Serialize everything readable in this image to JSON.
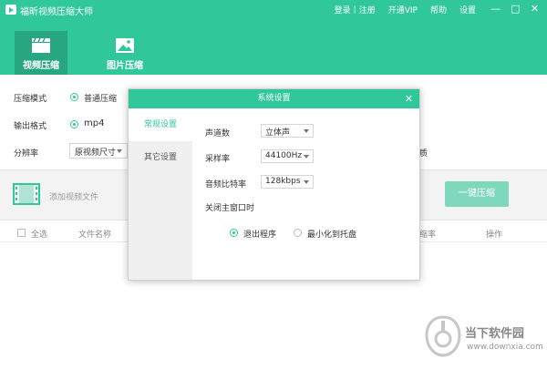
{
  "app": {
    "title": "福昕视频压缩大师"
  },
  "top_menu": {
    "login": "登录",
    "separator": "|",
    "register": "注册",
    "vip": "开通VIP",
    "help": "帮助",
    "settings": "设置"
  },
  "window_controls": {
    "minimize": "—",
    "maximize": "□",
    "close": "✕"
  },
  "main_tabs": [
    {
      "label": "视频压缩",
      "icon": "clapperboard-icon",
      "active": true
    },
    {
      "label": "图片压缩",
      "icon": "image-icon",
      "active": false
    }
  ],
  "settings": {
    "mode_label": "压缩模式",
    "mode_value": "普通压缩",
    "format_label": "输出格式",
    "format_value": "mp4",
    "resolution_label": "分辨率",
    "resolution_value": "原视频尺寸",
    "quality_partial": "质"
  },
  "toolbar": {
    "add_label": "添加视频文件",
    "compress_button": "一键压缩"
  },
  "table": {
    "select_all": "全选",
    "filename": "文件名称",
    "ratio_partial": "缩率",
    "action": "操作"
  },
  "dialog": {
    "title": "系统设置",
    "close": "✕",
    "side_items": [
      "常规设置",
      "其它设置"
    ],
    "channels_label": "声道数",
    "channels_value": "立体声",
    "sample_rate_label": "采样率",
    "sample_rate_value": "44100Hz",
    "bitrate_label": "音频比特率",
    "bitrate_value": "128kbps",
    "close_main_label": "关闭主窗口时",
    "exit_option": "退出程序",
    "minimize_option": "最小化到托盘"
  },
  "watermark": {
    "brand": "当下软件园",
    "url": "www.downxia.com"
  },
  "colors": {
    "accent": "#30c79a",
    "accent_dark": "#27a680",
    "button_light": "#7fd8bc"
  }
}
